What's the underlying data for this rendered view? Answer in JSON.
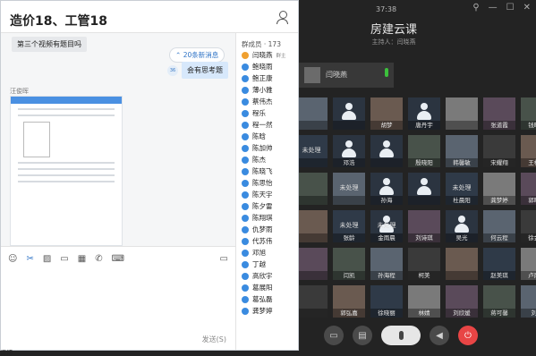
{
  "meeting": {
    "time": "37:38",
    "title": "房建云课",
    "host_line": "主持人：闫晓燕",
    "host_tile_name": "闫晓燕",
    "unprocessed_label": "未处理",
    "grid_names": [
      [
        "",
        "",
        "胡梦",
        "唐丹宇",
        "",
        "张道霞",
        "钱旺禹"
      ],
      [
        "",
        "邓浩",
        "",
        "殷晓阳",
        "韩馨敏",
        "宋耀翔",
        "王梓凝"
      ],
      [
        "",
        "",
        "孙海",
        "",
        "杜晨阳",
        "龚梦婷",
        "郭晓妮"
      ],
      [
        "",
        "张龄",
        "金雨晨",
        "刘诗琪",
        "吴光",
        "何云程",
        "徐金超"
      ],
      [
        "",
        "闫凯",
        "孙海程",
        "柯美",
        "",
        "赵美琪",
        "卢雨宏"
      ],
      [
        "",
        "郭弘嘉",
        "徐晓丽",
        "林婧",
        "刘欣媛",
        "蒋可馨",
        "刘萌"
      ]
    ]
  },
  "chat": {
    "title": "造价18、工管18",
    "msg_in": "第三个视频有题目吗",
    "new_messages": "20条新消息",
    "my_avatar": "36",
    "msg_out": "会有思考题",
    "sender": "汪俊晖",
    "send_label": "发送(S)",
    "members_header": "群成员 · 173",
    "owner_tag": "群主",
    "members": [
      "闫晓燕",
      "鲍晓雨",
      "鲍正康",
      "薄小雅",
      "蔡伟杰",
      "程乐",
      "程一然",
      "陈晗",
      "陈加帅",
      "陈杰",
      "陈晓飞",
      "陈思怡",
      "陈天宇",
      "陈夕雷",
      "陈翔琪",
      "仇梦雨",
      "代苏伟",
      "邓旭",
      "丁越",
      "高欣宇",
      "葛展阳",
      "葛弘磊",
      "龚梦婷"
    ]
  },
  "footer": {
    "fragment": "评博"
  }
}
